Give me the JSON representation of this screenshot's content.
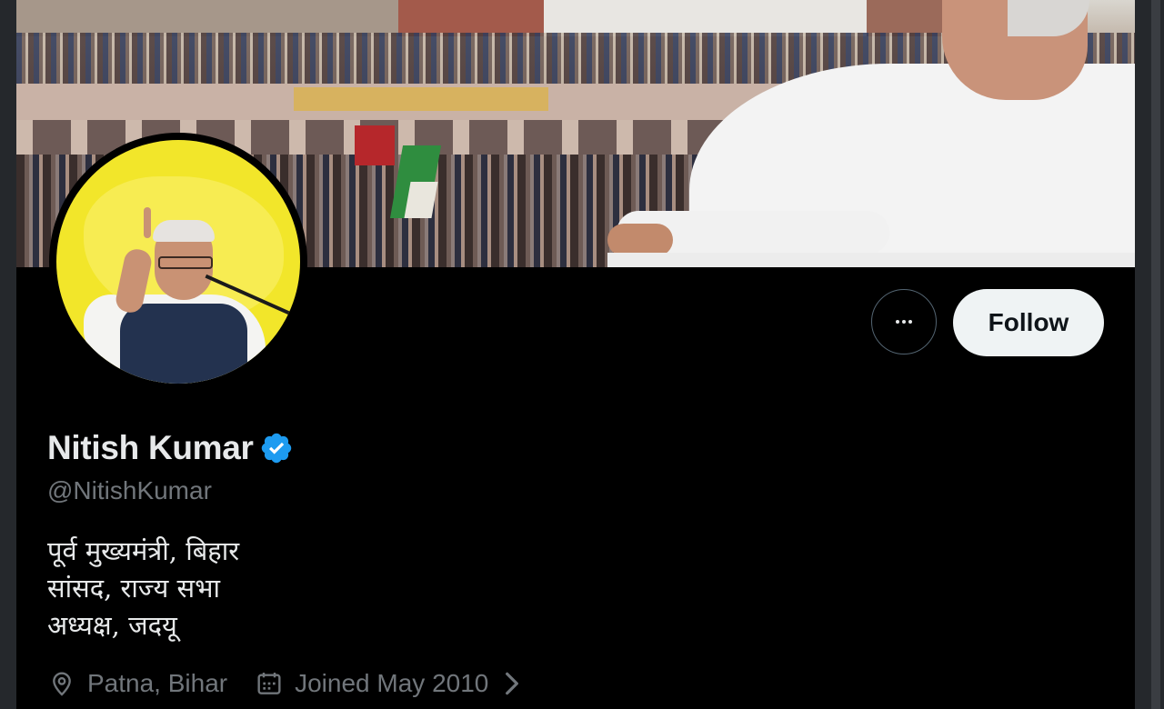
{
  "profile": {
    "name": "Nitish Kumar",
    "handle": "@NitishKumar",
    "verified": true,
    "bio": [
      "पूर्व मुख्यमंत्री, बिहार",
      "सांसद, राज्य सभा",
      "अध्यक्ष, जदयू"
    ],
    "location": "Patna, Bihar",
    "joined": "Joined May 2010"
  },
  "actions": {
    "follow_label": "Follow",
    "more_icon": "more-dots-icon"
  },
  "icons": {
    "location": "location-pin-icon",
    "calendar": "calendar-icon",
    "verified": "verified-badge-icon",
    "chevron": "chevron-right-icon"
  },
  "colors": {
    "background": "#000000",
    "primary_text": "#e7e9ea",
    "secondary_text": "#71767b",
    "verified_blue": "#1d9bf0",
    "follow_bg": "#eff3f4",
    "avatar_bg": "#f2e62a"
  }
}
